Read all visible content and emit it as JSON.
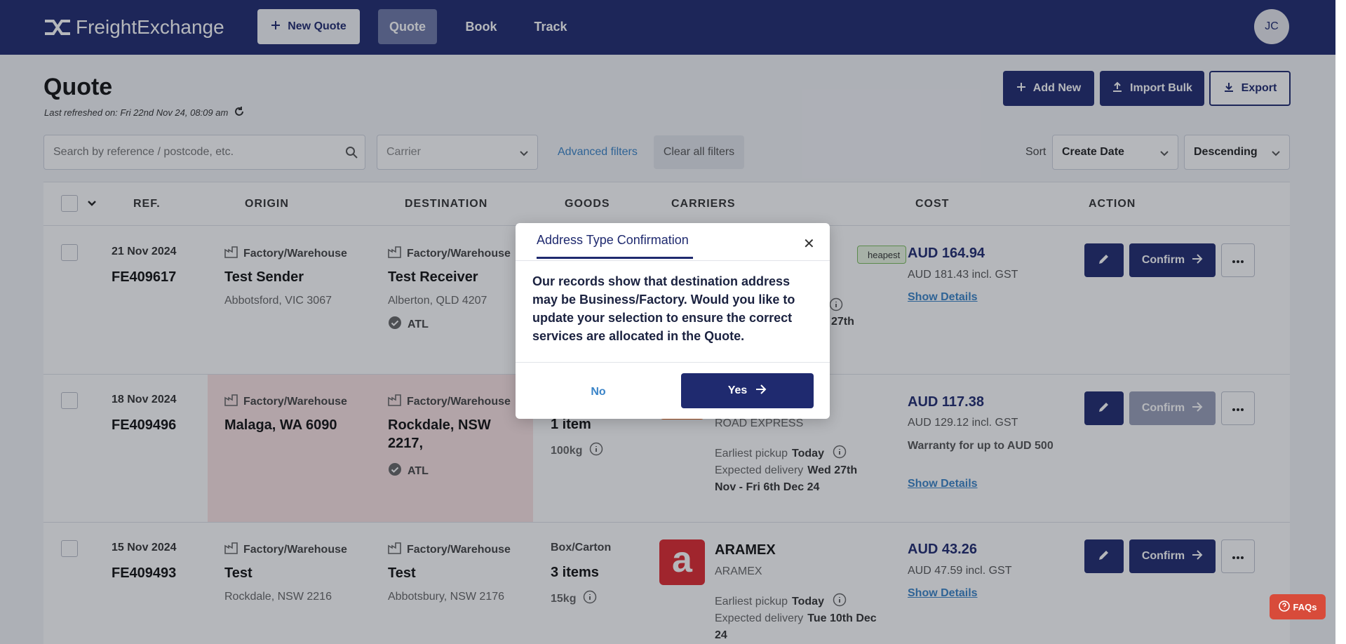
{
  "nav": {
    "logo_text": "FreightExchange",
    "new_quote": "New Quote",
    "tabs": [
      "Quote",
      "Book",
      "Track"
    ],
    "avatar_initials": "JC"
  },
  "header": {
    "title": "Quote",
    "refreshed": "Last refreshed on: Fri 22nd Nov 24, 08:09 am",
    "add_new": "Add New",
    "import_bulk": "Import Bulk",
    "export": "Export"
  },
  "filters": {
    "search_placeholder": "Search by reference / postcode, etc.",
    "carrier_placeholder": "Carrier",
    "advanced": "Advanced filters",
    "clear": "Clear all filters",
    "sort_label": "Sort",
    "sort_by": "Create Date",
    "sort_order": "Descending"
  },
  "table": {
    "headers": [
      "REF.",
      "ORIGIN",
      "DESTINATION",
      "GOODS",
      "CARRIERS",
      "COST",
      "ACTION"
    ],
    "confirm_label": "Confirm",
    "show_details": "Show Details",
    "cheapest_badge": "heapest",
    "rows": [
      {
        "date": "21 Nov 2024",
        "ref": "FE409617",
        "origin_type": "Factory/Warehouse",
        "origin_name": "Test Sender",
        "origin_addr": "Abbotsford, VIC 3067",
        "dest_type": "Factory/Warehouse",
        "dest_name": "Test Receiver",
        "dest_addr": "Alberton, QLD 4207",
        "dest_atl": "ATL",
        "delivery_partial": "27th",
        "cost": "AUD 164.94",
        "cost_gst": "AUD 181.43 incl. GST"
      },
      {
        "date": "18 Nov 2024",
        "ref": "FE409496",
        "origin_type": "Factory/Warehouse",
        "origin_name": "Malaga, WA 6090",
        "dest_type": "Factory/Warehouse",
        "dest_name_1": "Rockdale, NSW",
        "dest_name_2": "2217,",
        "dest_atl": "ATL",
        "goods_items": "1 item",
        "goods_weight": "100kg",
        "carrier_sub": "ROAD EXPRESS",
        "pickup_label": "Earliest pickup",
        "pickup_value": "Today",
        "delivery_label": "Expected delivery",
        "delivery_value_1": "Wed 27th",
        "delivery_value_2": "Nov - Fri 6th Dec 24",
        "cost": "AUD 117.38",
        "cost_gst": "AUD 129.12 incl. GST",
        "warranty": "Warranty for up to AUD 500"
      },
      {
        "date": "15 Nov 2024",
        "ref": "FE409493",
        "origin_type": "Factory/Warehouse",
        "origin_name": "Test",
        "origin_addr": "Rockdale, NSW 2216",
        "dest_type": "Factory/Warehouse",
        "dest_name": "Test",
        "dest_addr": "Abbotsbury, NSW 2176",
        "goods_type": "Box/Carton",
        "goods_items": "3 items",
        "goods_weight": "15kg",
        "carrier_name": "ARAMEX",
        "carrier_sub": "ARAMEX",
        "carrier_logo_letter": "a",
        "pickup_label": "Earliest pickup",
        "pickup_value": "Today",
        "delivery_label": "Expected delivery",
        "delivery_value_1": "Tue 10th Dec",
        "delivery_value_2": "24",
        "cost": "AUD 43.26",
        "cost_gst": "AUD 47.59 incl. GST"
      }
    ]
  },
  "modal": {
    "title": "Address Type Confirmation",
    "body": "Our records show that destination address may be Business/Factory. Would you like to update your selection to ensure the correct services are allocated in the Quote.",
    "no": "No",
    "yes": "Yes"
  },
  "faq": "FAQs",
  "colors": {
    "brand": "#1f2a6f",
    "link": "#3a84c8",
    "faq": "#d84b3a",
    "aramex": "#e0282e",
    "road_express": "#ef6a1e"
  }
}
